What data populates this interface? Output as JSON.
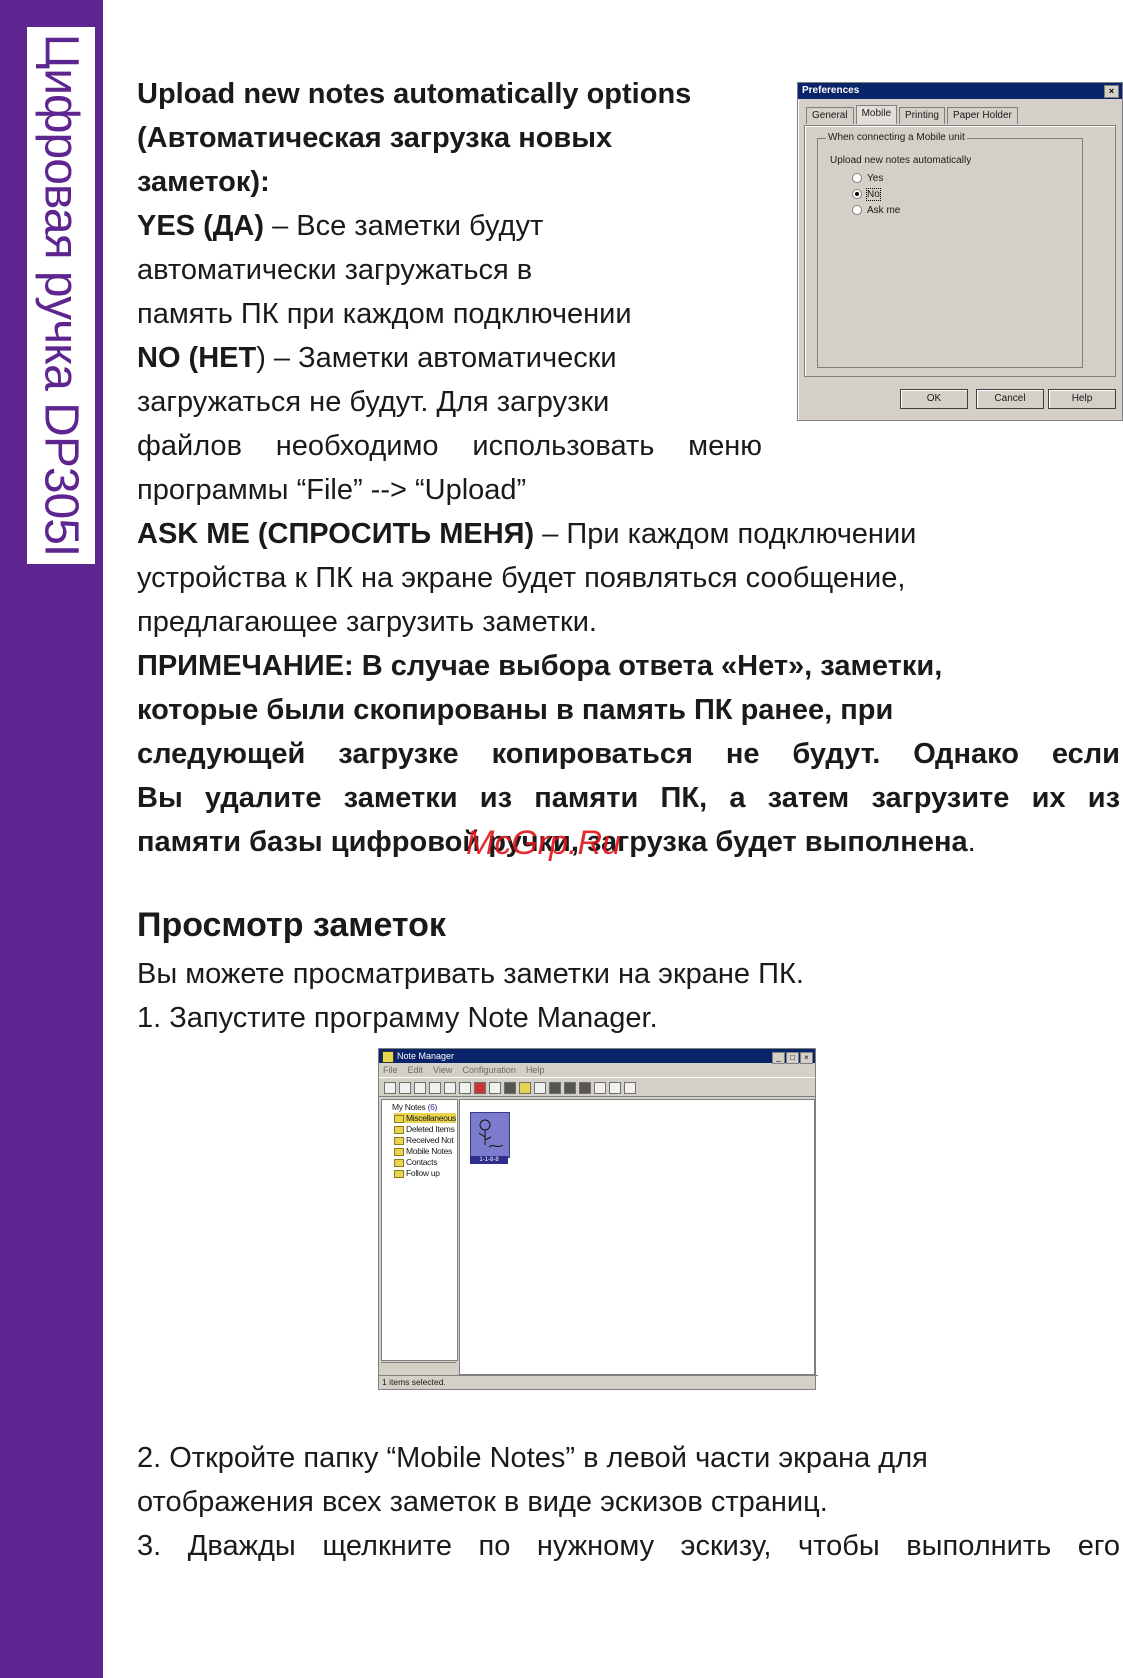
{
  "sidebar": {
    "title": "Цифровая ручка DP305I"
  },
  "section1": {
    "heading_line1": "Upload new notes automatically options",
    "heading_line2": "(Автоматическая загрузка новых",
    "heading_line3": "заметок):",
    "yes_label": "YES (ДА)",
    "yes_text1": " – Все заметки будут",
    "yes_text2": "автоматически загружаться в",
    "yes_text3": "память ПК при каждом подключении",
    "no_label": "NO (НЕТ",
    "no_text1": ") – Заметки автоматически",
    "no_text2": "загружаться не будут. Для загрузки",
    "no_text3": "файлов необходимо использовать меню",
    "no_text4": "программы “File” --> “Upload”",
    "ask_label": "ASK ME (СПРОСИТЬ МЕНЯ)",
    "ask_text1": " – При каждом подключении",
    "ask_text2": "устройства к ПК на экране будет появляться сообщение,",
    "ask_text3": "предлагающее загрузить заметки.",
    "note1": "ПРИМЕЧАНИЕ: В случае выбора ответа «Нет», заметки,",
    "note2": "которые были скопированы в память ПК ранее, при",
    "note3": "следующей загрузке копироваться не будут. Однако если",
    "note4": "Вы удалите заметки из памяти ПК, а затем загрузите их из",
    "note5": "памяти базы цифровой ручки, загрузка будет выполнена",
    "note5_end": "."
  },
  "watermark": "McGrp.Ru",
  "preferences_dialog": {
    "title": "Preferences",
    "close": "×",
    "tabs": [
      "General",
      "Mobile",
      "Printing",
      "Paper Holder"
    ],
    "group_label": "When connecting a Mobile unit",
    "option_label": "Upload new notes automatically",
    "options": [
      "Yes",
      "No",
      "Ask me"
    ],
    "selected": "No",
    "buttons": {
      "ok": "OK",
      "cancel": "Cancel",
      "help": "Help"
    }
  },
  "section2": {
    "heading": "Просмотр заметок",
    "line1": "Вы можете просматривать заметки на экране ПК.",
    "step1": "1. Запустите программу Note Manager.",
    "step2a": "2. Откройте папку “Mobile Notes” в левой части экрана для",
    "step2b": "отображения всех заметок в виде эскизов страниц.",
    "step3": "3. Дважды щелкните по нужному эскизу, чтобы выполнить его"
  },
  "note_manager": {
    "title": "Note Manager",
    "controls": [
      "_",
      "□",
      "×"
    ],
    "menu": [
      "File",
      "Edit",
      "View",
      "Configuration",
      "Help"
    ],
    "tree": {
      "root": "My Notes",
      "root_count": "(6)",
      "items": [
        "Miscellaneous",
        "Deleted Items",
        "Received Not",
        "Mobile Notes",
        "Contacts",
        "Follow up"
      ]
    },
    "thumbnail_caption": "1-1-8-8",
    "status": "1 items selected."
  },
  "colors": {
    "sidebar": "#5e2590",
    "watermark": "#e0161b",
    "titlebar": "#0a246a"
  }
}
